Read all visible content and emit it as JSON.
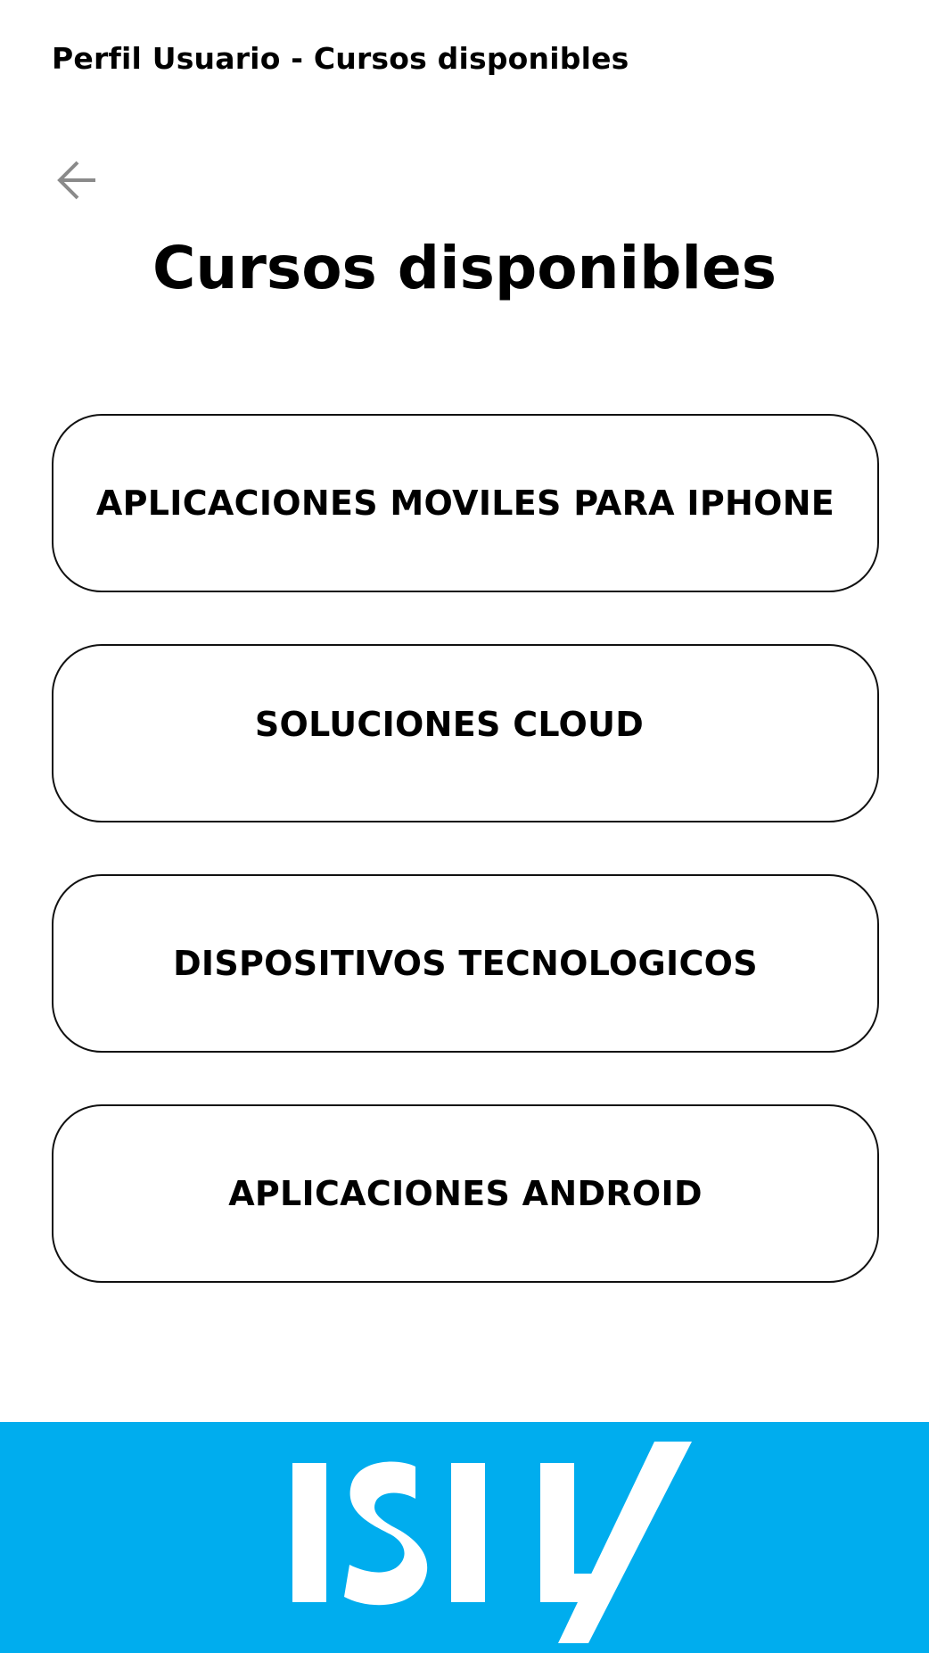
{
  "header": {
    "screen_title": "Perfil Usuario - Cursos disponibles"
  },
  "nav": {
    "back_icon": "arrow-left-icon",
    "icon_color": "#8a8a8a"
  },
  "main": {
    "heading": "Cursos disponibles",
    "courses": [
      {
        "label": "APLICACIONES MOVILES PARA IPHONE"
      },
      {
        "label": "SOLUCIONES CLOUD"
      },
      {
        "label": "DISPOSITIVOS TECNOLOGICOS"
      },
      {
        "label": "APLICACIONES ANDROID"
      }
    ]
  },
  "footer": {
    "brand_text": "ISIL",
    "brand_color": "#00adee"
  }
}
